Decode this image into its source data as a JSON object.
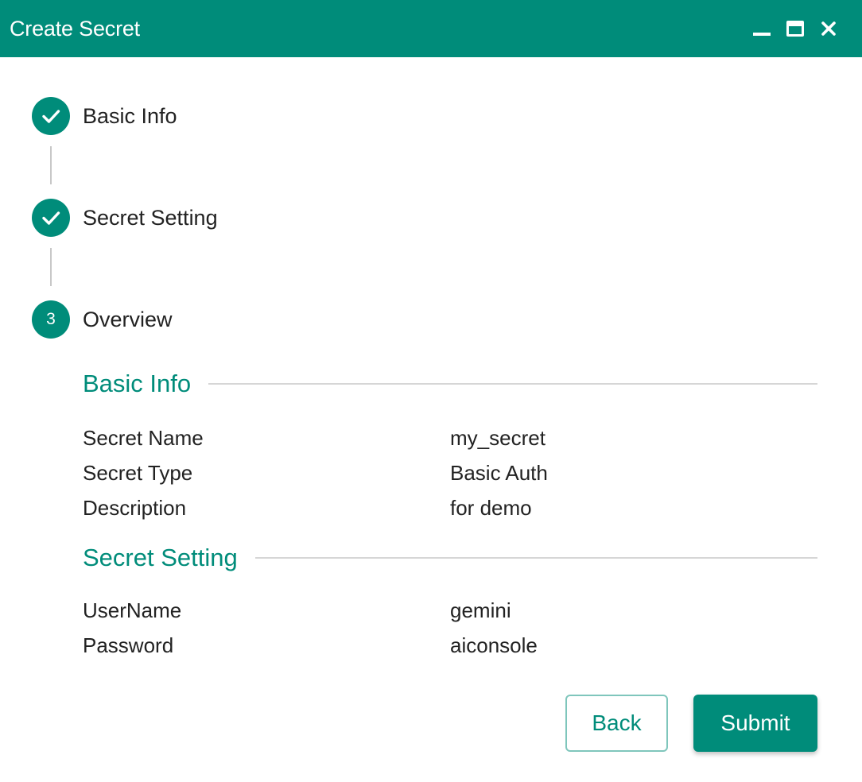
{
  "window": {
    "title": "Create Secret",
    "controls": [
      "minimize-icon",
      "maximize-icon",
      "close-icon"
    ]
  },
  "colors": {
    "accent": "#008c7a",
    "divider": "#d6d6d6",
    "connector": "#c8c8c8",
    "text": "#222222"
  },
  "stepper": {
    "steps": [
      {
        "label": "Basic Info",
        "state": "completed",
        "icon": "check-icon"
      },
      {
        "label": "Secret Setting",
        "state": "completed",
        "icon": "check-icon"
      },
      {
        "label": "Overview",
        "state": "active",
        "number": "3"
      }
    ]
  },
  "overview": {
    "basic_info": {
      "title": "Basic Info",
      "rows": [
        {
          "key": "Secret Name",
          "value": "my_secret"
        },
        {
          "key": "Secret Type",
          "value": "Basic Auth"
        },
        {
          "key": "Description",
          "value": "for demo"
        }
      ]
    },
    "secret_setting": {
      "title": "Secret Setting",
      "rows": [
        {
          "key": "UserName",
          "value": "gemini"
        },
        {
          "key": "Password",
          "value": "aiconsole"
        }
      ]
    }
  },
  "actions": {
    "back_label": "Back",
    "submit_label": "Submit"
  }
}
